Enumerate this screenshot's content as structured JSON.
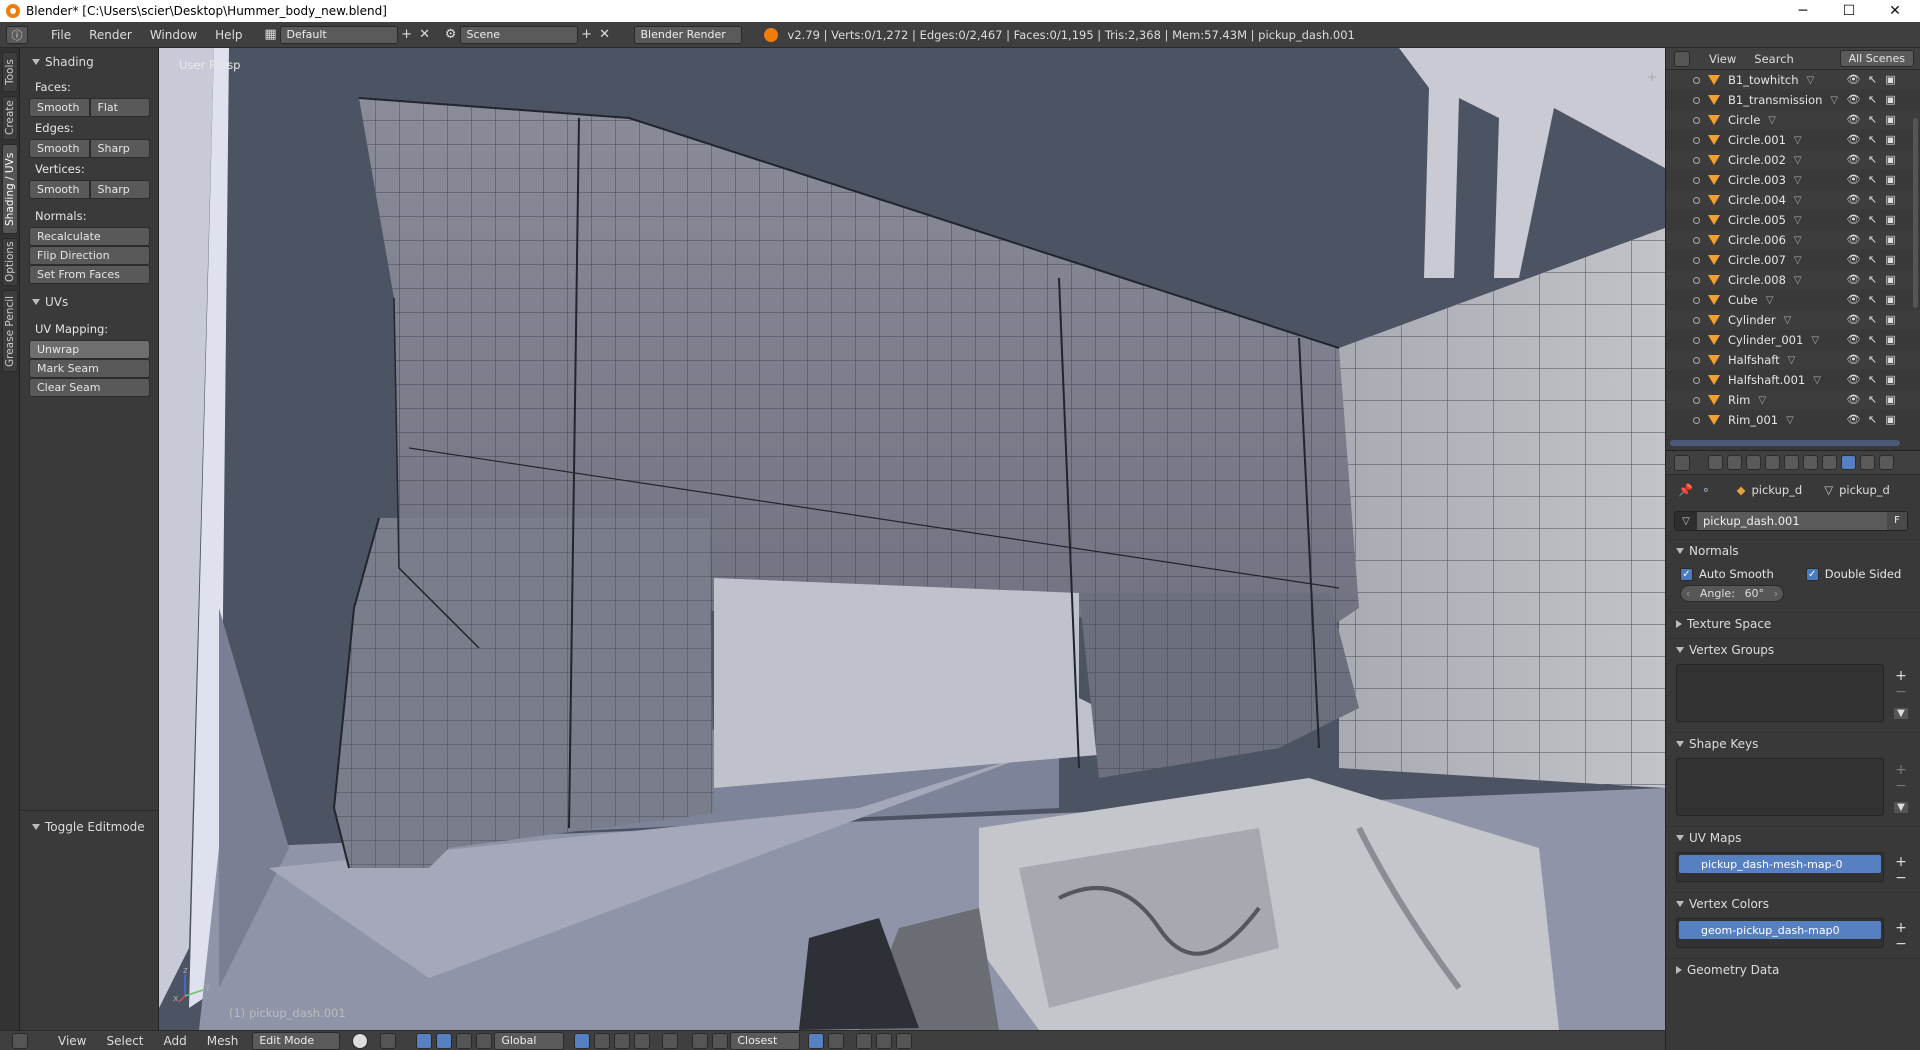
{
  "window": {
    "title": "Blender* [C:\\Users\\scier\\Desktop\\Hummer_body_new.blend]",
    "controls": [
      "─",
      "☐",
      "✕"
    ]
  },
  "infobar": {
    "menus": [
      "File",
      "Render",
      "Window",
      "Help"
    ],
    "layout": "Default",
    "scene": "Scene",
    "engine": "Blender Render",
    "stats": "v2.79 | Verts:0/1,272 | Edges:0/2,467 | Faces:0/1,195 | Tris:2,368 | Mem:57.43M | pickup_dash.001"
  },
  "tabs": [
    "Tools",
    "Create",
    "Shading / UVs",
    "Options",
    "Grease Pencil"
  ],
  "toolshelf": {
    "shading_title": "Shading",
    "faces_label": "Faces:",
    "faces_btns": [
      "Smooth",
      "Flat"
    ],
    "edges_label": "Edges:",
    "edges_btns": [
      "Smooth",
      "Sharp"
    ],
    "verts_label": "Vertices:",
    "verts_btns": [
      "Smooth",
      "Sharp"
    ],
    "normals_label": "Normals:",
    "normals_btns": [
      "Recalculate",
      "Flip Direction",
      "Set From Faces"
    ],
    "uvs_title": "UVs",
    "uvmap_label": "UV Mapping:",
    "uv_btns": [
      "Unwrap",
      "Mark Seam",
      "Clear Seam"
    ],
    "toggle": "Toggle Editmode"
  },
  "viewport": {
    "persp": "User Persp",
    "object": "(1) pickup_dash.001",
    "axis_z": "z",
    "axis_y": "y",
    "axis_x": "x"
  },
  "bottombar": {
    "menus": [
      "View",
      "Select",
      "Add",
      "Mesh"
    ],
    "mode": "Edit Mode",
    "orientation": "Global",
    "snap": "Closest"
  },
  "outliner": {
    "menus": [
      "View",
      "Search"
    ],
    "filter": "All Scenes",
    "items": [
      "B1_towhitch",
      "B1_transmission",
      "Circle",
      "Circle.001",
      "Circle.002",
      "Circle.003",
      "Circle.004",
      "Circle.005",
      "Circle.006",
      "Circle.007",
      "Circle.008",
      "Cube",
      "Cylinder",
      "Cylinder_001",
      "Halfshaft",
      "Halfshaft.001",
      "Rim",
      "Rim_001"
    ]
  },
  "properties": {
    "context_obj": "pickup_d",
    "context_mesh": "pickup_d",
    "mesh_name": "pickup_dash.001",
    "fake_user": "F",
    "normals_title": "Normals",
    "auto_smooth": "Auto Smooth",
    "double_sided": "Double Sided",
    "angle_label": "Angle:",
    "angle_value": "60°",
    "texture_space": "Texture Space",
    "vertex_groups": "Vertex Groups",
    "shape_keys": "Shape Keys",
    "uv_maps": "UV Maps",
    "uv_map_item": "pickup_dash-mesh-map-0",
    "vertex_colors": "Vertex Colors",
    "vc_item": "geom-pickup_dash-map0",
    "geometry_data": "Geometry Data"
  }
}
